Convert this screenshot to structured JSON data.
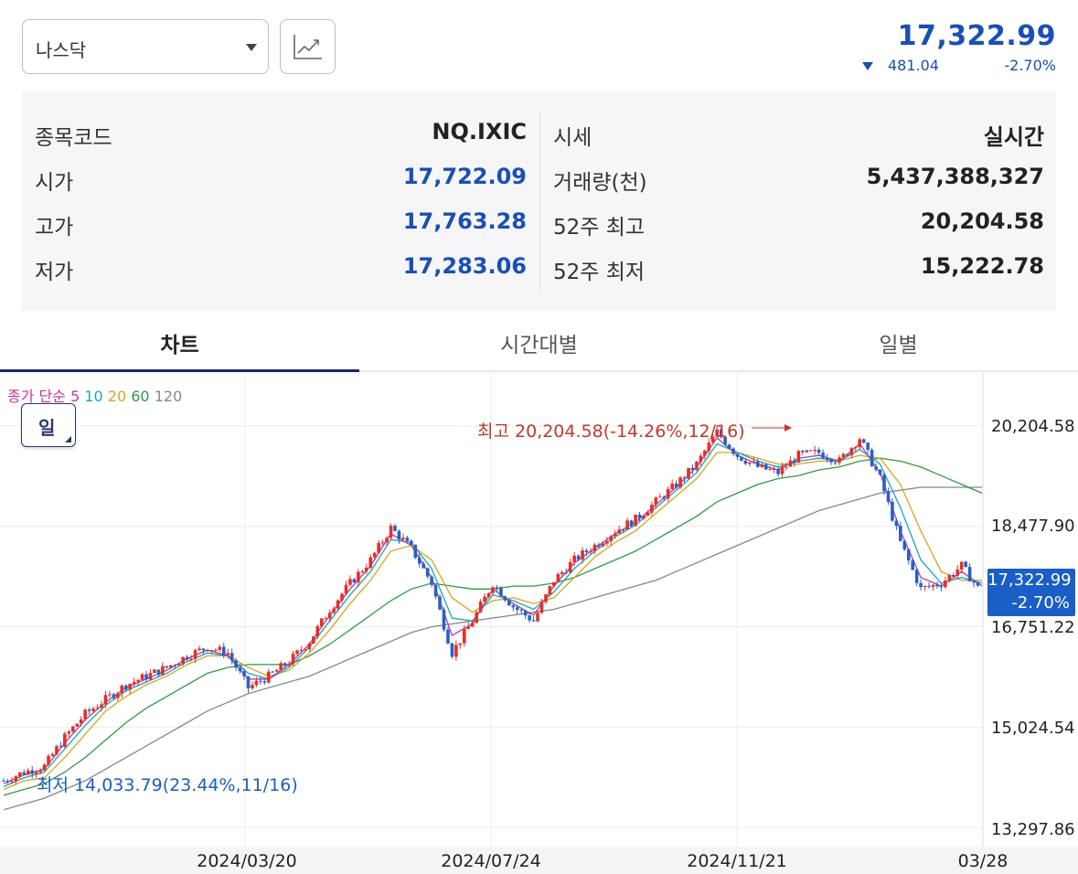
{
  "header": {
    "market_select": "나스닥",
    "price": "17,322.99",
    "change_abs": "481.04",
    "change_pct": "-2.70%"
  },
  "info": {
    "left": [
      {
        "label": "종목코드",
        "value": "NQ.IXIC"
      },
      {
        "label": "시가",
        "value": "17,722.09"
      },
      {
        "label": "고가",
        "value": "17,763.28"
      },
      {
        "label": "저가",
        "value": "17,283.06"
      }
    ],
    "right": [
      {
        "label": "시세",
        "value": "실시간"
      },
      {
        "label": "거래량(천)",
        "value": "5,437,388,327"
      },
      {
        "label": "52주 최고",
        "value": "20,204.58"
      },
      {
        "label": "52주 최저",
        "value": "15,222.78"
      }
    ]
  },
  "tabs": [
    "차트",
    "시간대별",
    "일별"
  ],
  "chart": {
    "legend": {
      "prefix": "종가 단순",
      "ma5": "5",
      "ma10": "10",
      "ma20": "20",
      "ma60": "60",
      "ma120": "120"
    },
    "period_button": "일",
    "annotation_high": "최고 20,204.58(-14.26%,12/16)",
    "annotation_low": "최저 14,033.79(23.44%,11/16)",
    "price_tag_value": "17,322.99",
    "price_tag_pct": "-2.70%",
    "colors": {
      "up": "#e0312b",
      "down": "#2a5fc7",
      "ma5": "#c0399a",
      "ma10": "#1aa6c0",
      "ma20": "#d6a520",
      "ma60": "#2f9a46",
      "ma120": "#888888"
    }
  },
  "chart_data": {
    "type": "candlestick",
    "title": "",
    "y_ticks": [
      "20,204.58",
      "18,477.90",
      "16,751.22",
      "15,024.54",
      "13,297.86"
    ],
    "x_ticks": [
      "2024/03/20",
      "2024/07/24",
      "2024/11/21",
      "03/28"
    ],
    "ylim": [
      13297.86,
      20204.58
    ],
    "series": [
      {
        "name": "종가",
        "values": [
          14100,
          14250,
          14350,
          14850,
          15250,
          15500,
          15750,
          15900,
          16050,
          16250,
          16400,
          16300,
          15700,
          15900,
          16150,
          16500,
          17050,
          17500,
          17900,
          18450,
          18100,
          17500,
          16300,
          16850,
          17500,
          17100,
          16850,
          17550,
          17900,
          18150,
          18400,
          18600,
          18900,
          19200,
          19550,
          20100,
          19700,
          19500,
          19400,
          19700,
          19750,
          19600,
          20000,
          19300,
          18200,
          17400,
          17500,
          17800,
          17322.99
        ]
      },
      {
        "name": "5",
        "values": [
          14050,
          14200,
          14300,
          14750,
          15150,
          15450,
          15700,
          15850,
          16000,
          16200,
          16350,
          16250,
          15850,
          15850,
          16100,
          16450,
          16950,
          17400,
          17800,
          18350,
          18150,
          17600,
          16600,
          16800,
          17400,
          17150,
          16950,
          17450,
          17850,
          18100,
          18350,
          18550,
          18850,
          19150,
          19500,
          20000,
          19700,
          19550,
          19450,
          19650,
          19700,
          19600,
          19900,
          19400,
          18400,
          17600,
          17450,
          17700,
          17450
        ]
      },
      {
        "name": "10",
        "values": [
          14000,
          14150,
          14250,
          14650,
          15050,
          15400,
          15650,
          15800,
          15950,
          16150,
          16300,
          16250,
          15950,
          15850,
          16050,
          16400,
          16850,
          17300,
          17700,
          18250,
          18200,
          17750,
          16900,
          16850,
          17300,
          17200,
          17050,
          17350,
          17750,
          18050,
          18300,
          18500,
          18800,
          19100,
          19400,
          19900,
          19750,
          19600,
          19500,
          19600,
          19650,
          19600,
          19800,
          19550,
          18800,
          17900,
          17500,
          17600,
          17500
        ]
      },
      {
        "name": "20",
        "values": [
          13950,
          14100,
          14150,
          14500,
          14900,
          15300,
          15550,
          15750,
          15900,
          16100,
          16250,
          16250,
          16050,
          15900,
          16000,
          16300,
          16700,
          17150,
          17550,
          18050,
          18150,
          17900,
          17250,
          17000,
          17200,
          17250,
          17150,
          17250,
          17600,
          17950,
          18200,
          18400,
          18700,
          19000,
          19300,
          19750,
          19750,
          19650,
          19550,
          19550,
          19600,
          19600,
          19700,
          19650,
          19200,
          18400,
          17700,
          17550,
          17550
        ]
      },
      {
        "name": "60",
        "values": [
          13850,
          13950,
          14050,
          14250,
          14500,
          14800,
          15100,
          15350,
          15550,
          15750,
          15950,
          16050,
          16100,
          16100,
          16100,
          16250,
          16450,
          16700,
          16950,
          17200,
          17400,
          17500,
          17450,
          17400,
          17400,
          17450,
          17450,
          17500,
          17600,
          17750,
          17900,
          18050,
          18250,
          18450,
          18650,
          18900,
          19050,
          19200,
          19300,
          19350,
          19450,
          19500,
          19600,
          19650,
          19600,
          19500,
          19350,
          19200,
          19050
        ]
      },
      {
        "name": "120",
        "values": [
          13600,
          13700,
          13800,
          13950,
          14100,
          14300,
          14500,
          14700,
          14900,
          15100,
          15300,
          15450,
          15600,
          15700,
          15800,
          15900,
          16050,
          16200,
          16350,
          16500,
          16650,
          16750,
          16800,
          16850,
          16900,
          16950,
          17000,
          17050,
          17150,
          17250,
          17350,
          17450,
          17550,
          17700,
          17850,
          18000,
          18150,
          18300,
          18450,
          18600,
          18750,
          18850,
          18950,
          19050,
          19100,
          19150,
          19150,
          19150,
          19150
        ]
      }
    ]
  }
}
